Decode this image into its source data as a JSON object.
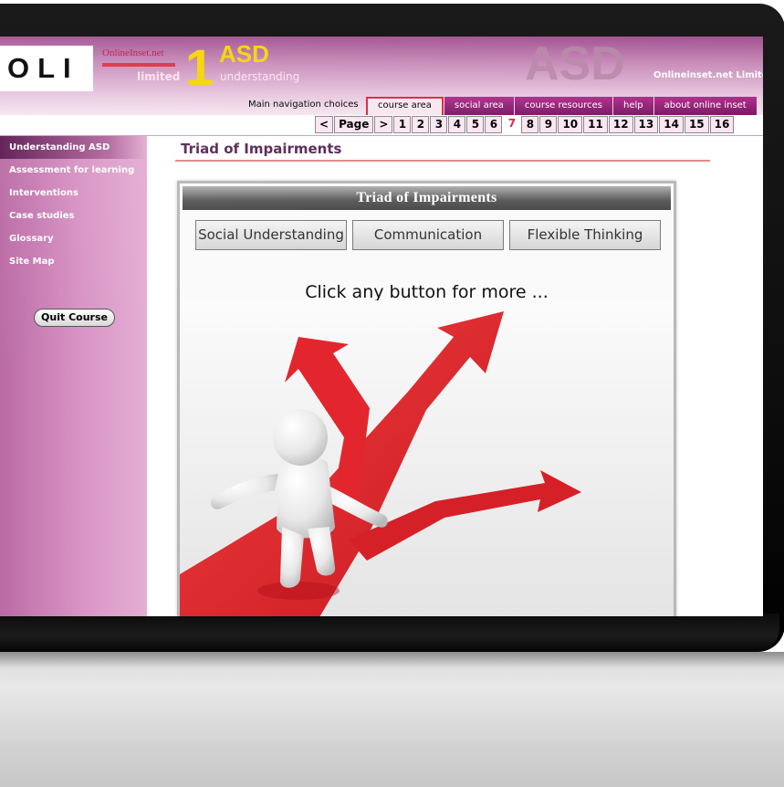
{
  "header": {
    "logo_text": "OLI",
    "brand_name": "OnlineInset.net",
    "brand_limited": "limited",
    "course_number": "1",
    "course_title": "ASD",
    "course_subtitle": "understanding",
    "watermark": "ASD",
    "company": "Onlineinset.net Limited"
  },
  "nav": {
    "label": "Main navigation choices",
    "tabs": [
      {
        "label": "course area",
        "active": true
      },
      {
        "label": "social area"
      },
      {
        "label": "course resources"
      },
      {
        "label": "help"
      },
      {
        "label": "about online inset"
      }
    ]
  },
  "pager": {
    "prev": "<",
    "label": "Page",
    "next": ">",
    "pages": [
      "1",
      "2",
      "3",
      "4",
      "5",
      "6",
      "7",
      "8",
      "9",
      "10",
      "11",
      "12",
      "13",
      "14",
      "15",
      "16"
    ],
    "current": "7"
  },
  "sidebar": {
    "items": [
      {
        "label": "Understanding ASD",
        "active": true
      },
      {
        "label": "Assessment for learning"
      },
      {
        "label": "Interventions"
      },
      {
        "label": "Case studies"
      },
      {
        "label": "Glossary"
      },
      {
        "label": "Site Map"
      }
    ],
    "quit_label": "Quit Course"
  },
  "main": {
    "page_title": "Triad of Impairments",
    "panel": {
      "title": "Triad of Impairments",
      "buttons": [
        "Social Understanding",
        "Communication",
        "Flexible Thinking"
      ],
      "hint": "Click any button for more ..."
    }
  },
  "colors": {
    "accent": "#a0508f",
    "active_tab_border": "#e02840",
    "arrow_red": "#e0202a",
    "title_color": "#5a2a56"
  }
}
